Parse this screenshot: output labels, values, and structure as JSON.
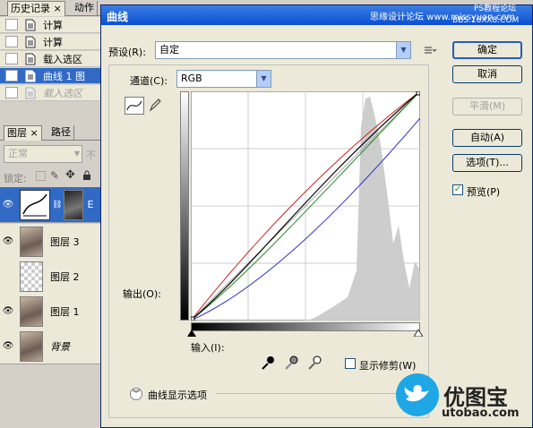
{
  "history": {
    "tabs": [
      "历史记录",
      "动作"
    ],
    "close": "×",
    "items": [
      {
        "label": "计算",
        "state": "normal"
      },
      {
        "label": "计算",
        "state": "normal"
      },
      {
        "label": "载入选区",
        "state": "normal"
      },
      {
        "label": "曲线 1 图",
        "state": "selected"
      },
      {
        "label": "载入选区",
        "state": "dim"
      }
    ]
  },
  "layers": {
    "tabs": [
      "图层",
      "路径"
    ],
    "close": "×",
    "blend_mode": "正常",
    "opacity_abbrev": "不",
    "lock_label": "锁定:",
    "items": [
      {
        "label": "E",
        "type": "curves"
      },
      {
        "label": "图层 3",
        "type": "photo"
      },
      {
        "label": "图层 2",
        "type": "transparent"
      },
      {
        "label": "图层 1",
        "type": "photo"
      },
      {
        "label": "背景",
        "type": "photo"
      }
    ]
  },
  "dialog": {
    "title": "曲线",
    "watermark1": "思缘设计论坛 www.missyuan.com",
    "watermark2": "PS教程论坛",
    "watermark3": "BBS.16XX8.COM",
    "preset_label": "预设(R):",
    "preset_value": "自定",
    "channel_label": "通道(C):",
    "channel_value": "RGB",
    "output_label": "输出(O):",
    "input_label": "输入(I):",
    "show_clipping_label": "显示修剪(W)",
    "curve_options_label": "曲线显示选项",
    "buttons": {
      "ok": "确定",
      "cancel": "取消",
      "smooth": "平滑(M)",
      "auto": "自动(A)",
      "options": "选项(T)...",
      "preview": "预览(P)"
    },
    "preview_checked": true
  },
  "brand": {
    "name": "优图宝",
    "url": "utobao.com"
  },
  "curve": {
    "histogram_color": "#c8c8c8",
    "rgb_color": "#000000",
    "red_color": "#cc2222",
    "green_color": "#228822",
    "blue_color": "#3333cc",
    "composite_color": "#444444"
  }
}
